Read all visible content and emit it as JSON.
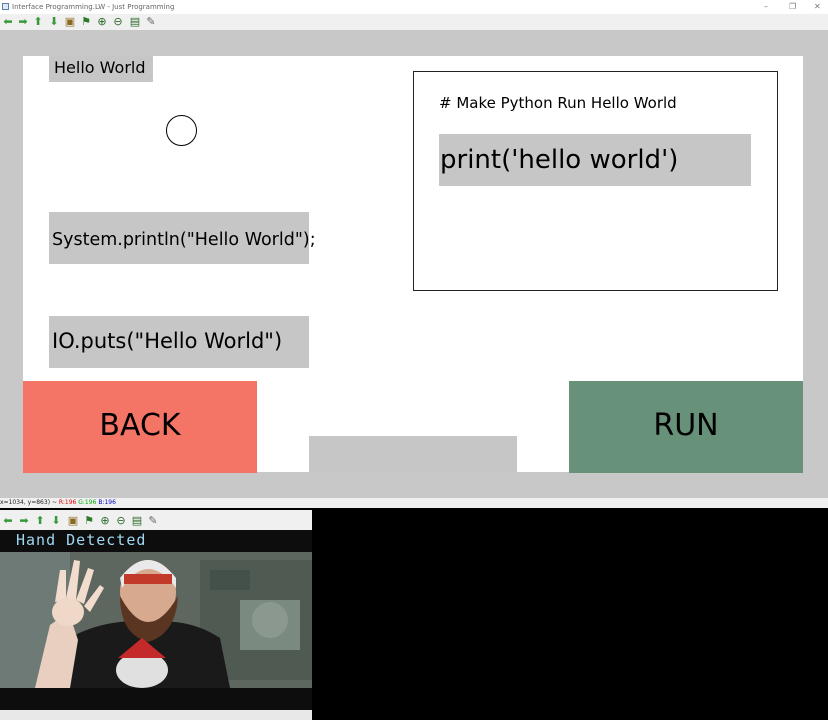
{
  "window": {
    "title": "Interface Programming.LW - Just Programming",
    "controls": [
      "–",
      "❐",
      "✕"
    ]
  },
  "toolbar_icons": [
    "arrow-left-icon",
    "arrow-right-icon",
    "arrow-up-icon",
    "arrow-down-icon",
    "save-image-icon",
    "flag-icon",
    "zoom-in-icon",
    "zoom-out-icon",
    "floppy-icon",
    "pin-icon"
  ],
  "canvas": {
    "hello_label": "Hello World",
    "java_code": "System.println(\"Hello World\");",
    "ruby_code": "IO.puts(\"Hello World\")",
    "python_comment": "# Make Python Run Hello World",
    "python_code": "print('hello world')",
    "back_label": "BACK",
    "run_label": "RUN"
  },
  "status": {
    "coords": "x=1034, y=863) ~ ",
    "r": "R:196",
    "g": "G:196",
    "b": "B:196"
  },
  "camera": {
    "overlay_text": "Hand Detected"
  },
  "colors": {
    "back": "#f47465",
    "run": "#68917a",
    "panel_gray": "#c6c6c6"
  }
}
